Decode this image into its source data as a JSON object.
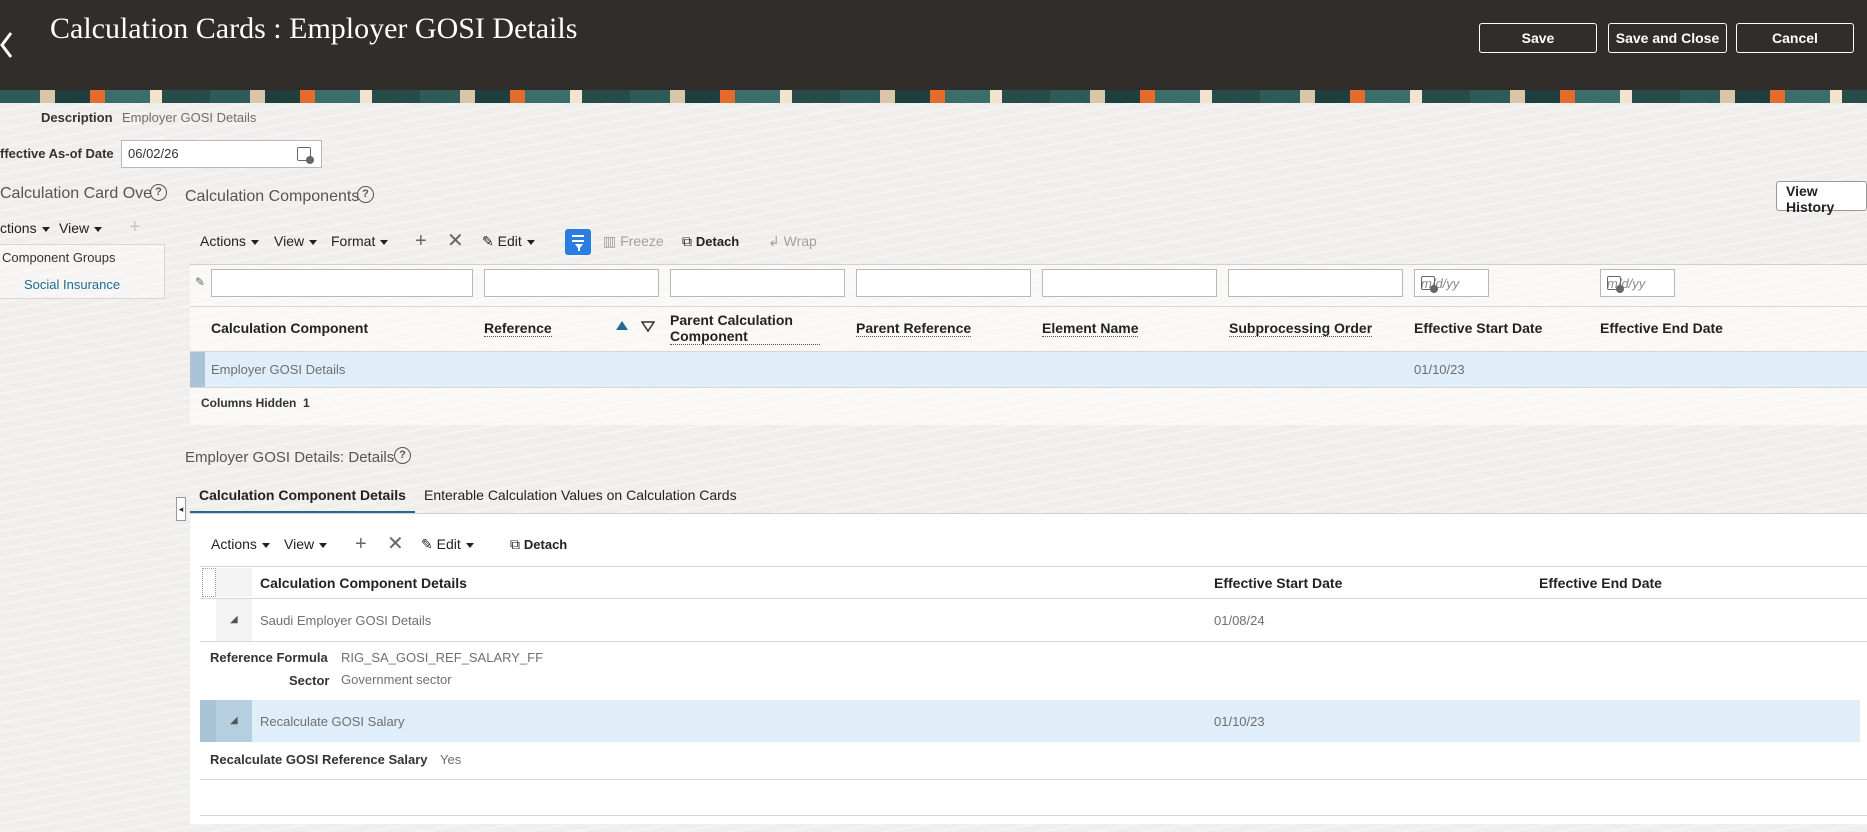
{
  "header": {
    "title": "Calculation Cards : Employer GOSI Details",
    "save_label": "Save",
    "save_close_label": "Save and Close",
    "cancel_label": "Cancel"
  },
  "form": {
    "description_label": "Description",
    "description_value": "Employer GOSI Details",
    "as_of_label": "ffective As-of Date",
    "as_of_value": "06/02/26"
  },
  "overview": {
    "title": "Calculation Card Ove",
    "actions_label": "ctions",
    "view_label": "View",
    "items": [
      "Component Groups",
      "Social Insurance"
    ]
  },
  "components": {
    "title": "Calculation Components",
    "view_history": "View History",
    "toolbar": {
      "actions": "Actions",
      "view": "View",
      "format": "Format",
      "edit": "Edit",
      "freeze": "Freeze",
      "detach": "Detach",
      "wrap": "Wrap"
    },
    "date_placeholder": "m/d/yy",
    "columns": [
      "Calculation Component",
      "Reference",
      "Parent Calculation Component",
      "Parent Reference",
      "Element Name",
      "Subprocessing Order",
      "Effective Start Date",
      "Effective End Date"
    ],
    "rows": [
      {
        "calculation_component": "Employer GOSI Details",
        "effective_start_date": "01/10/23"
      }
    ],
    "columns_hidden_label": "Columns Hidden",
    "columns_hidden_count": "1"
  },
  "details": {
    "title": "Employer GOSI Details: Details",
    "tabs": [
      "Calculation Component Details",
      "Enterable Calculation Values on Calculation Cards"
    ],
    "toolbar": {
      "actions": "Actions",
      "view": "View",
      "edit": "Edit",
      "detach": "Detach"
    },
    "columns": [
      "Calculation Component Details",
      "Effective Start Date",
      "Effective End Date"
    ],
    "rows": [
      {
        "name": "Saudi Employer GOSI Details",
        "start": "01/08/24",
        "fields": [
          {
            "label": "Reference Formula",
            "value": "RIG_SA_GOSI_REF_SALARY_FF"
          },
          {
            "label": "Sector",
            "value": "Government sector"
          }
        ]
      },
      {
        "name": "Recalculate GOSI Salary",
        "start": "01/10/23",
        "fields": [
          {
            "label": "Recalculate GOSI Reference Salary",
            "value": "Yes"
          }
        ]
      }
    ]
  }
}
